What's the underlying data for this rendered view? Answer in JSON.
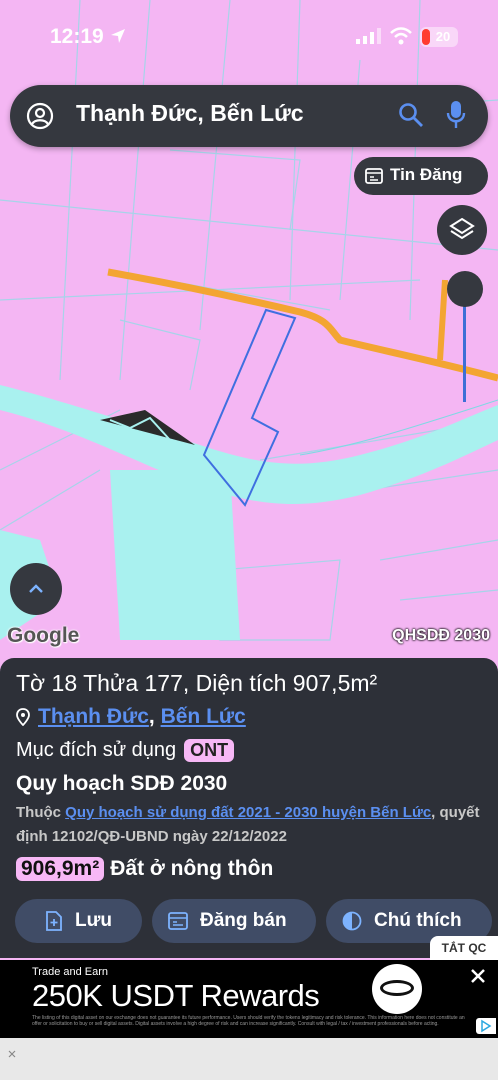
{
  "status_bar": {
    "time": "12:19",
    "battery": "20"
  },
  "search": {
    "query": "Thạnh Đức, Bến Lức"
  },
  "tin_dang_label": "Tin Đăng",
  "map_labels": {
    "google": "Google",
    "layer_name": "QHSDĐ 2030"
  },
  "panel": {
    "title": "Tờ 18 Thửa 177, Diện tích 907,5m²",
    "ward": "Thạnh Đức",
    "separator": ",",
    "district": "Bến Lức",
    "purpose_label": "Mục đích sử dụng",
    "purpose_code": "ONT",
    "plan_title": "Quy hoạch SDĐ 2030",
    "note_prefix": "Thuộc",
    "note_link": "Quy hoạch sử dụng đất 2021 - 2030 huyện Bến Lức",
    "note_suffix": ", quyết định 12102/QĐ-UBND ngày 22/12/2022",
    "area_value": "906,9m²",
    "area_type": "Đất ở nông thôn",
    "buttons": {
      "save": "Lưu",
      "post": "Đăng bán",
      "legend": "Chú thích"
    }
  },
  "ad": {
    "close_ads": "TẮT QC",
    "small_text": "Trade and Earn",
    "headline": "250K USDT Rewards",
    "legal": "The listing of this digital asset on our exchange does not guarantee its future performance. Users should verify the tokens legitimacy and risk tolerance. This information here does not constitute an offer or solicitation to buy or sell digital assets. Digital assets involve a high degree of risk and can increase significantly. Consult with legal / tax / investment professionals before acting."
  },
  "colors": {
    "panel_bg": "#2d3038",
    "accent_blue": "#5b8ff0",
    "badge_pink": "#f7b8f6",
    "map_pink": "#f4b6f3",
    "water_cyan": "#a9f1ef",
    "road_orange": "#f3a532"
  }
}
